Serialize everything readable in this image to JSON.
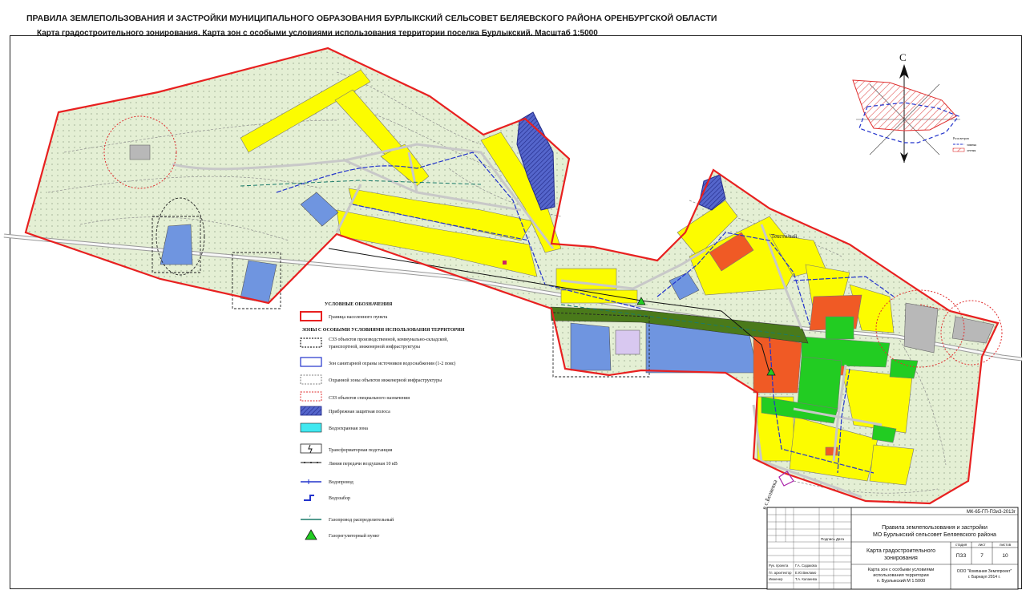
{
  "header": {
    "title": "ПРАВИЛА ЗЕМЛЕПОЛЬЗОВАНИЯ И ЗАСТРОЙКИ МУНИЦИПАЛЬНОГО ОБРАЗОВАНИЯ БУРЛЫКСКИЙ СЕЛЬСОВЕТ БЕЛЯЕВСКОГО РАЙОНА ОРЕНБУРГСКОЙ ОБЛАСТИ",
    "subtitle": "Карта градостроительного зонирования. Карта зон  с особыми условиями использования территории поселка Бурлыкский.  Масштаб 1:5000"
  },
  "compass": {
    "north_letter": "С",
    "wind_rose_title": "Роза ветров",
    "winter_label": "зимняя",
    "summer_label": "летняя",
    "colors": {
      "winter": "#2233cc",
      "summer": "#dd2222"
    }
  },
  "map_labels": {
    "street_tekstilny": "Текстилый",
    "road_to_belyaevka": "в с.Беляевка"
  },
  "legend": {
    "title": "УСЛОВНЫЕ ОБОЗНАЧЕНИЯ",
    "section_title": "ЗОНЫ С ОСОБЫМИ УСЛОВИЯМИ ИСПОЛЬЗОВАНИЯ ТЕРРИТОРИИ",
    "items": [
      {
        "key": "boundary",
        "label": "Граница населенного пункта"
      },
      {
        "key": "szz_industrial",
        "label": "СЗЗ объектов производственной, коммунально-складской,",
        "label2": "транспортной, инженерной инфраструктуры"
      },
      {
        "key": "water_protection",
        "label": "Зон санитарной охраны источников водоснабжения (1-2 пояс)"
      },
      {
        "key": "eng_protection",
        "label": "Охранной зоны объектов инженерной инфраструктуры"
      },
      {
        "key": "szz_special",
        "label": "СЗЗ объектов специального назначения"
      },
      {
        "key": "coastal",
        "label": "Прибрежная защитная полоса"
      },
      {
        "key": "water_zone",
        "label": "Водоохранная зона"
      },
      {
        "key": "transformer",
        "label": "Трансформаторная подстанция"
      },
      {
        "key": "powerline",
        "label": "Линия передачи воздушная 10 кВ"
      },
      {
        "key": "water_pipe",
        "label": "Водопровод"
      },
      {
        "key": "water_intake",
        "label": "Водозабор"
      },
      {
        "key": "gas_pipe",
        "label": "Газопровод распределительный"
      },
      {
        "key": "gas_point",
        "label": "Газорегуляторный пункт"
      }
    ]
  },
  "stamp": {
    "doc_code": "МК-65-ГП-ПЗиЗ-2013г",
    "project_title": "Правила землепользования и застройки",
    "project_title2": "МО Бурлыкский сельсовет Беляевского района",
    "sheet_name": "Карта градостроительного",
    "sheet_name2": "зонирования",
    "col_stage": "стадия",
    "col_sheet": "лист",
    "col_sheets": "листов",
    "stage": "ПЗЗ",
    "sheet": "7",
    "sheets": "10",
    "map_desc1": "Карта  зон  с особыми условиями",
    "map_desc2": "использования территории",
    "map_desc3": "п. Бурлыкский М 1:5000",
    "org1": "ООО \"Компания Землпроект\"",
    "org2": "г. Барнаул 2014 г.",
    "sign_label": "Подпись",
    "date_label": "Дата",
    "roles": [
      {
        "role": "Рук. проекта",
        "name": "Г.А. Садакова"
      },
      {
        "role": "Гл. архитектор",
        "name": "Е.Ю.Викламо"
      },
      {
        "role": "Инженер",
        "name": "Т.А. Калаенва"
      }
    ]
  }
}
